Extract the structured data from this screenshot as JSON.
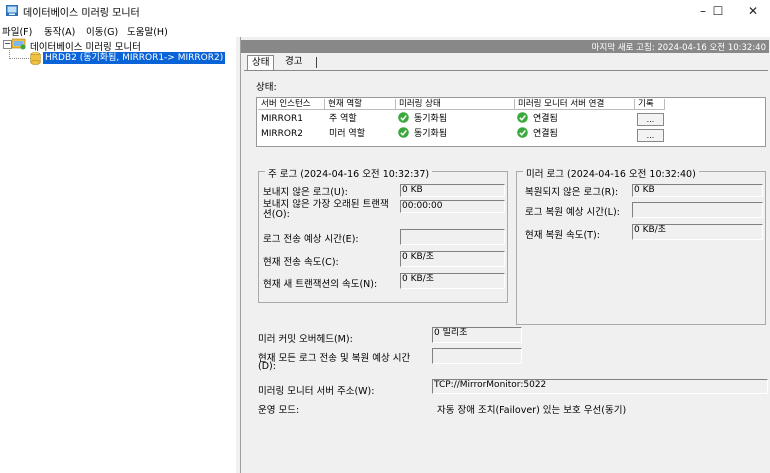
{
  "window": {
    "title": "데이터베이스 미러링 모니터",
    "minimize": "–",
    "maximize": "☐",
    "close": "✕"
  },
  "menu": [
    "파일(F)",
    "동작(A)",
    "이동(G)",
    "도움말(H)"
  ],
  "tree": {
    "expander": "−",
    "root_label": "데이터베이스 미러링 모니터",
    "child_label": "HRDB2 (동기화됨, MIRROR1-> MIRROR2)"
  },
  "refresh_text": "마지막 새로 고침: 2024-04-16 오전 10:32:40",
  "tabs": [
    "상태",
    "경고"
  ],
  "status_label": "상태:",
  "grid": {
    "headers": [
      "서버 인스턴스",
      "현재 역할",
      "미러링 상태",
      "미러링 모니터 서버 연결",
      "기록"
    ],
    "rows": [
      {
        "instance": "MIRROR1",
        "role": "주 역할",
        "mirroring_state": "동기화됨",
        "connection": "연결됨",
        "history": "..."
      },
      {
        "instance": "MIRROR2",
        "role": "미러 역할",
        "mirroring_state": "동기화됨",
        "connection": "연결됨",
        "history": "..."
      }
    ]
  },
  "principal_log": {
    "title": "주 로그 (2024-04-16 오전 10:32:37)",
    "unsent_log_label": "보내지 않은 로그(U):",
    "unsent_log_value": "0 KB",
    "oldest_unsent_label": "보내지 않은 가장 오래된 트랜잭션(O):",
    "oldest_unsent_value": "00:00:00",
    "time_to_send_label": "로그 전송 예상 시간(E):",
    "time_to_send_value": "",
    "send_rate_label": "현재 전송 속도(C):",
    "send_rate_value": "0 KB/초",
    "new_txn_rate_label": "현재 새 트랜잭션의 속도(N):",
    "new_txn_rate_value": "0 KB/초"
  },
  "mirror_log": {
    "title": "미러 로그 (2024-04-16 오전 10:32:40)",
    "unrestored_label": "복원되지 않은 로그(R):",
    "unrestored_value": "0 KB",
    "time_to_restore_label": "로그 복원 예상 시간(L):",
    "time_to_restore_value": "",
    "restore_rate_label": "현재 복원 속도(T):",
    "restore_rate_value": "0 KB/초"
  },
  "bottom": {
    "commit_overhead_label": "미러 커밋 오버헤드(M):",
    "commit_overhead_value": "0 밀리초",
    "time_all_label_1": "현재 모든 로그 전송 및 복원 예상 시간",
    "time_all_label_2": "(D):",
    "time_all_value": "",
    "witness_label": "미러링 모니터 서버 주소(W):",
    "witness_value": "TCP://MirrorMonitor:5022",
    "operating_mode_label": "운영 모드:",
    "operating_mode_value": "자동 장애 조치(Failover) 있는 보호 우선(동기)"
  },
  "icons": {
    "app": "monitor-app-icon",
    "root": "monitor-root-icon",
    "database": "database-icon",
    "status_ok": "green-check-icon"
  },
  "colors": {
    "selection": "#0a64d8",
    "refresh_bar": "#888888",
    "ok_green": "#3aa83a"
  }
}
